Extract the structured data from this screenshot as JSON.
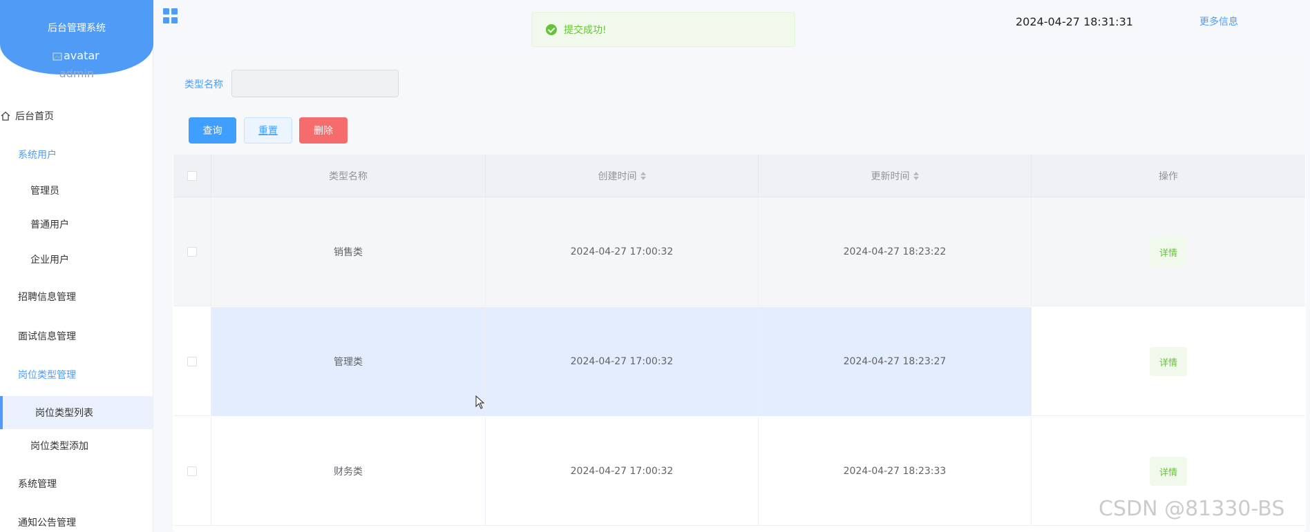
{
  "brand": {
    "title": "后台管理系统",
    "avatar_alt": "avatar",
    "username": "admin"
  },
  "sidebar": {
    "items": [
      {
        "label": "后台首页"
      },
      {
        "label": "系统用户"
      },
      {
        "label": "管理员"
      },
      {
        "label": "普通用户"
      },
      {
        "label": "企业用户"
      },
      {
        "label": "招聘信息管理"
      },
      {
        "label": "面试信息管理"
      },
      {
        "label": "岗位类型管理"
      },
      {
        "label": "岗位类型列表"
      },
      {
        "label": "岗位类型添加"
      },
      {
        "label": "系统管理"
      },
      {
        "label": "通知公告管理"
      }
    ]
  },
  "header": {
    "datetime": "2024-04-27 18:31:31",
    "more_info": "更多信息"
  },
  "toast": {
    "message": "提交成功!"
  },
  "search": {
    "label": "类型名称",
    "value": ""
  },
  "buttons": {
    "query": "查询",
    "reset": "重置",
    "delete": "删除"
  },
  "table": {
    "headers": {
      "name": "类型名称",
      "created": "创建时间",
      "updated": "更新时间",
      "actions": "操作"
    },
    "rows": [
      {
        "name": "销售类",
        "created": "2024-04-27 17:00:32",
        "updated": "2024-04-27 18:23:22",
        "action": "详情"
      },
      {
        "name": "管理类",
        "created": "2024-04-27 17:00:32",
        "updated": "2024-04-27 18:23:27",
        "action": "详情"
      },
      {
        "name": "财务类",
        "created": "2024-04-27 17:00:32",
        "updated": "2024-04-27 18:23:33",
        "action": "详情"
      }
    ]
  },
  "watermark": "CSDN @81330-BS",
  "colors": {
    "primary": "#409eff",
    "brand": "#4f9bf6",
    "success": "#67c23a",
    "danger": "#f56c6c"
  }
}
